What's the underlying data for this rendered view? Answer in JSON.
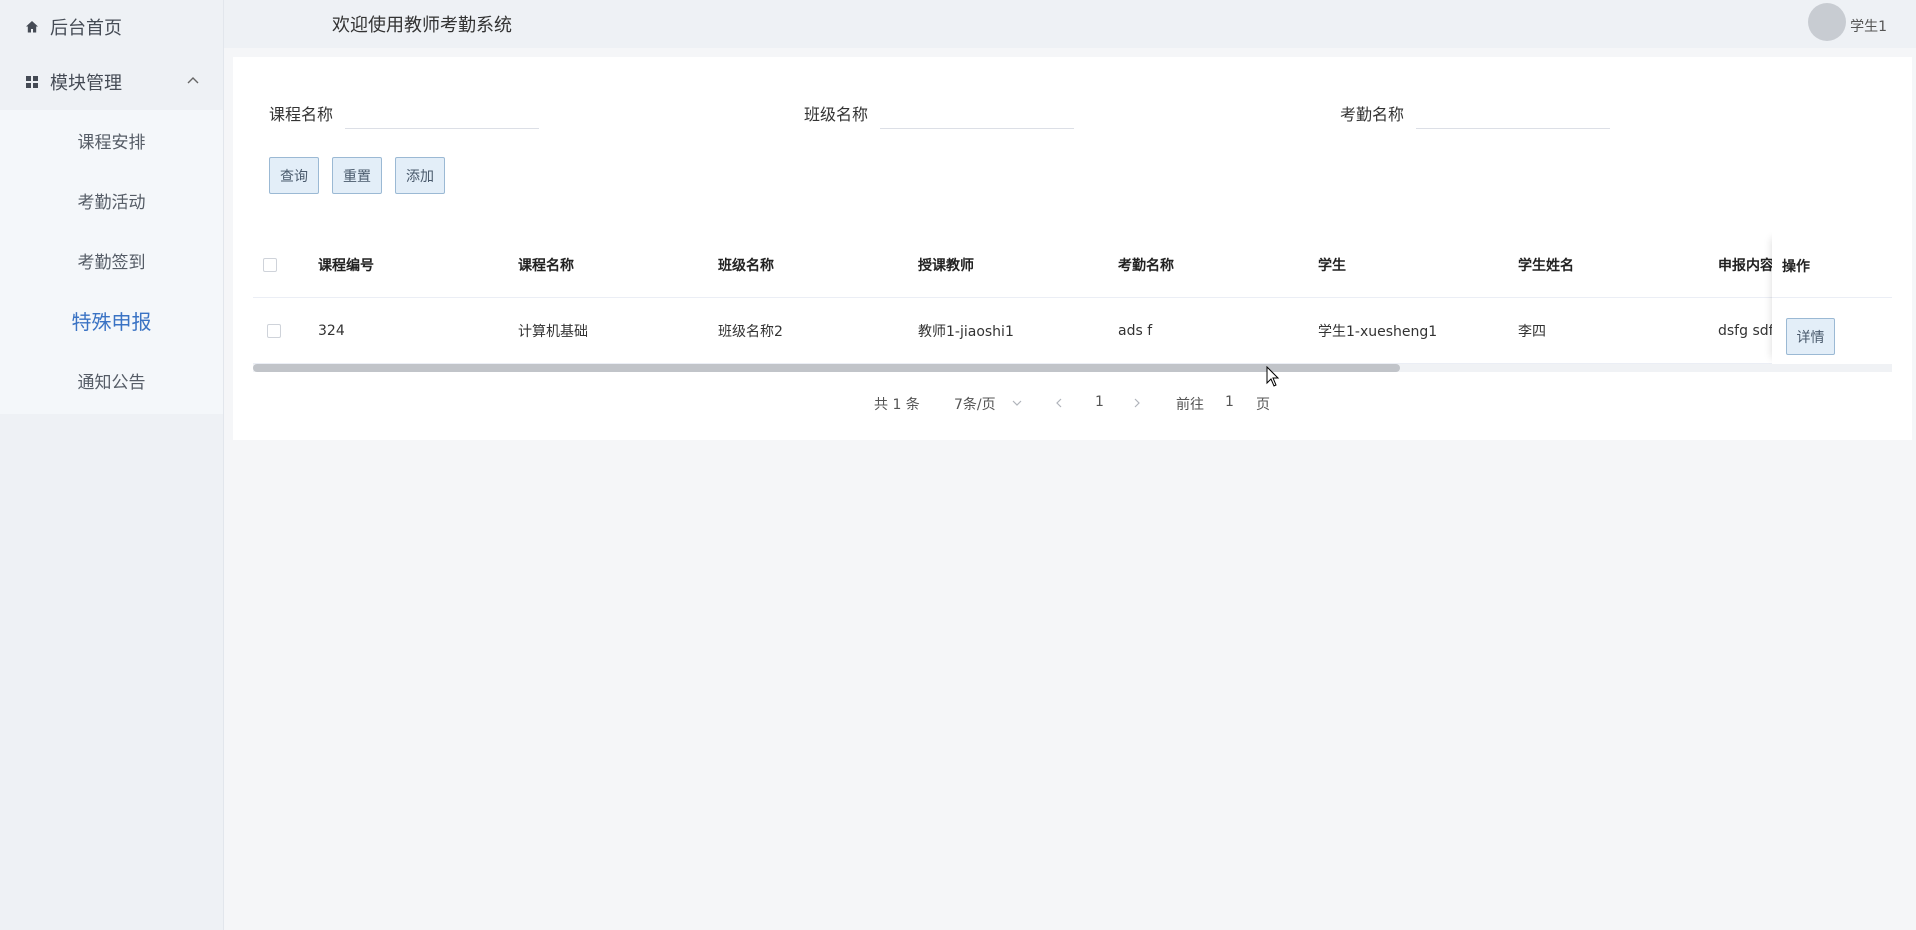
{
  "sidebar": {
    "home_label": "后台首页",
    "group_label": "模块管理",
    "items": [
      {
        "label": "课程安排"
      },
      {
        "label": "考勤活动"
      },
      {
        "label": "考勤签到"
      },
      {
        "label": "特殊申报"
      },
      {
        "label": "通知公告"
      }
    ],
    "active_index": 3
  },
  "header": {
    "title": "欢迎使用教师考勤系统",
    "username": "学生1"
  },
  "search": {
    "fields": [
      {
        "label": "课程名称",
        "value": "",
        "placeholder": ""
      },
      {
        "label": "班级名称",
        "value": "",
        "placeholder": ""
      },
      {
        "label": "考勤名称",
        "value": "",
        "placeholder": ""
      }
    ],
    "query_label": "查询",
    "reset_label": "重置",
    "add_label": "添加"
  },
  "table": {
    "columns": [
      "课程编号",
      "课程名称",
      "班级名称",
      "授课教师",
      "考勤名称",
      "学生",
      "学生姓名",
      "申报内容"
    ],
    "action_header": "操作",
    "rows": [
      {
        "cells": [
          "324",
          "计算机基础",
          "班级名称2",
          "教师1-jiaoshi1",
          "ads f",
          "学生1-xuesheng1",
          "李四",
          "dsfg sdfg"
        ],
        "action_label": "详情"
      }
    ],
    "scroll_fraction": 0.7
  },
  "pagination": {
    "total_text": "共 1 条",
    "page_size_text": "7条/页",
    "current_page": "1",
    "goto_prefix": "前往",
    "goto_value": "1",
    "goto_suffix": "页"
  },
  "colors": {
    "accent": "#3a73c4",
    "button_bg": "#e3eef8",
    "button_border": "#9bb9d4",
    "sidebar_bg": "#eef1f5"
  }
}
